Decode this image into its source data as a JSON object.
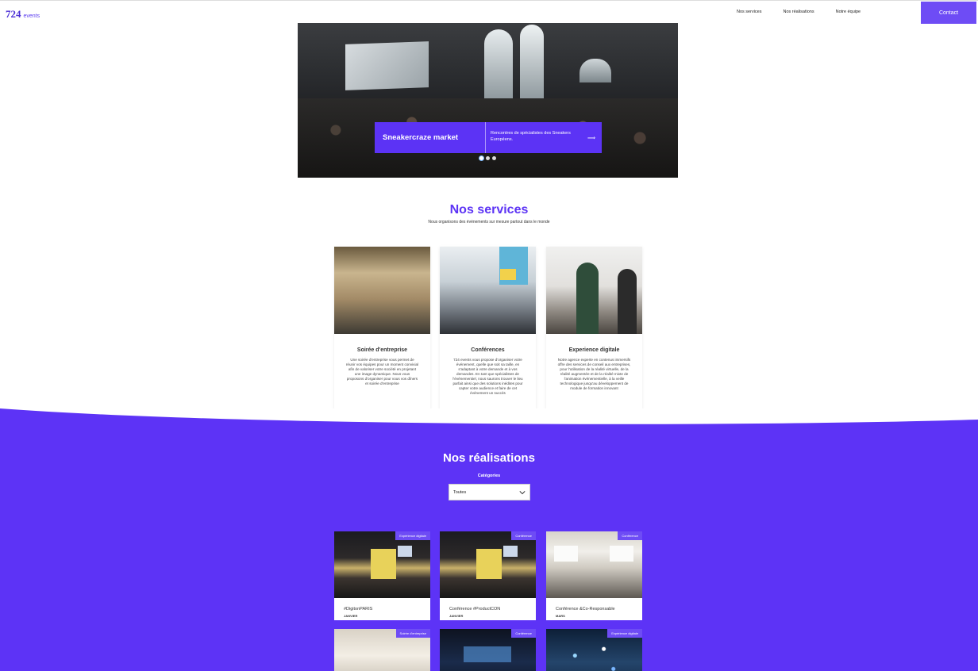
{
  "header": {
    "logo_number": "724",
    "logo_word": "events",
    "nav": [
      "Nos services",
      "Nos réalisations",
      "Notre équipe"
    ],
    "contact_label": "Contact"
  },
  "hero": {
    "slide_title": "Sneakercraze market",
    "slide_description": "Rencontres de spécialistes des Sneakers Européens.",
    "slide_arrow": "⟹",
    "slide_count": 3,
    "active_slide": 1
  },
  "services": {
    "title": "Nos services",
    "subtitle": "Nous organisons des événements sur mesure partout dans le monde",
    "cards": [
      {
        "title": "Soirée d'entreprise",
        "text": "Une soirée d'entreprise vous permet de réunir vos équipes pour un moment convivial afin de valoriser votre société en projetant une image dynamique. Nous vous proposons d'organiser pour vous vos dîners et soirée d'entreprise"
      },
      {
        "title": "Conférences",
        "text": "724 events vous propose d'organiser votre événement, quelle que soit sa taille, en s'adaptant à votre demande et à vos demandes. En tant que spécialistes de l'événementiel, nous saurons trouver le lieu parfait ainsi que des solutions inédites pour capter votre audience et faire de cet événement un succès"
      },
      {
        "title": "Experience digitale",
        "text": "Notre agence experte en contenus immersifs offre des services de conseil aux entreprises, pour l'utilisation de la réalité virtuelle, de la réalité augmentée et de la réalité mixte de l'animation événementielle, à la veille technologique jusqu'au développement de module de formation innovant"
      }
    ]
  },
  "realisations": {
    "title": "Nos réalisations",
    "category_label": "Catégories",
    "category_selected": "Toutes",
    "cards": [
      {
        "tag": "Expérience digitale",
        "name": "#DigitonPARIS",
        "year": "JANVIER"
      },
      {
        "tag": "Conférence",
        "name": "Conférence #ProductCON",
        "year": "JANVIER"
      },
      {
        "tag": "Conférence",
        "name": "Conférence &Co-Responsable",
        "year": "MARS"
      },
      {
        "tag": "Soirée d'entreprise",
        "name": "",
        "year": ""
      },
      {
        "tag": "Conférence",
        "name": "",
        "year": ""
      },
      {
        "tag": "Expérience digitale",
        "name": "",
        "year": ""
      }
    ]
  },
  "colors": {
    "brand": "#5c33f5",
    "contact_button": "#6e4cf5",
    "background": "#ffffff"
  }
}
